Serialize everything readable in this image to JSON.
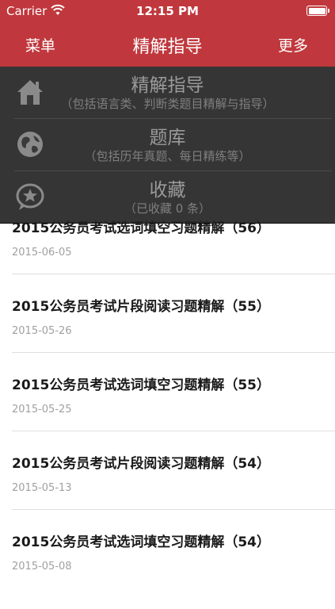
{
  "status_bar": {
    "carrier": "Carrier",
    "time": "12:15 PM"
  },
  "nav": {
    "menu_label": "菜单",
    "title": "精解指导",
    "more_label": "更多"
  },
  "dropdown": {
    "items": [
      {
        "title": "精解指导",
        "subtitle": "（包括语言类、判断类题目精解与指导）",
        "icon": "home-icon"
      },
      {
        "title": "题库",
        "subtitle": "（包括历年真题、每日精练等）",
        "icon": "globe-icon"
      },
      {
        "title": "收藏",
        "subtitle": "（已收藏 0 条）",
        "icon": "star-bubble-icon"
      }
    ]
  },
  "list": {
    "items": [
      {
        "title": "2015公务员考试选词填空习题精解（56）",
        "date": "2015-06-05"
      },
      {
        "title": "2015公务员考试片段阅读习题精解（55）",
        "date": "2015-05-26"
      },
      {
        "title": "2015公务员考试选词填空习题精解（55）",
        "date": "2015-05-25"
      },
      {
        "title": "2015公务员考试片段阅读习题精解（54）",
        "date": "2015-05-13"
      },
      {
        "title": "2015公务员考试选词填空习题精解（54）",
        "date": "2015-05-08"
      }
    ]
  },
  "colors": {
    "accent": "#c0383d",
    "overlay": "#262626",
    "date_text": "#a0a0a0"
  }
}
